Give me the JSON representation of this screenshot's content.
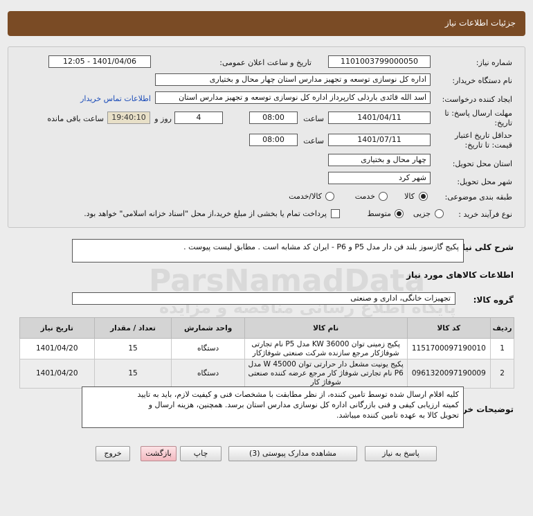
{
  "header": {
    "title": "جزئیات اطلاعات نیاز"
  },
  "form": {
    "need_number": {
      "label": "شماره نیاز:",
      "value": "1101003799000050"
    },
    "announce": {
      "label": "تاریخ و ساعت اعلان عمومی:",
      "value": "1401/04/06 - 12:05"
    },
    "buyer": {
      "label": "نام دستگاه خریدار:",
      "value": "اداره کل نوسازی  توسعه و تجهیز مدارس استان چهار محال و بختیاری"
    },
    "creator": {
      "label": "ایجاد کننده درخواست:",
      "value": "اسد الله قائدی بارذلی کارپرداز اداره کل نوسازی  توسعه و تجهیز مدارس استان",
      "contact_link": "اطلاعات تماس خریدار"
    },
    "deadline": {
      "label": "مهلت ارسال پاسخ: تا",
      "label2": "تاریخ:",
      "date": "1401/04/11",
      "time_label": "ساعت",
      "time": "08:00",
      "days": "4",
      "days_label": "روز و",
      "remaining": "19:40:10",
      "remaining_label": "ساعت باقی مانده"
    },
    "validity": {
      "label": "حداقل تاریخ اعتبار",
      "label2": "قیمت: تا تاریخ:",
      "date": "1401/07/11",
      "time_label": "ساعت",
      "time": "08:00"
    },
    "province": {
      "label": "استان محل تحویل:",
      "value": "چهار محال و بختیاری"
    },
    "city": {
      "label": "شهر محل تحویل:",
      "value": "شهر کرد"
    },
    "category": {
      "label": "طبقه بندی موضوعی:",
      "options": [
        "کالا",
        "خدمت",
        "کالا/خدمت"
      ],
      "selected": "کالا"
    },
    "process": {
      "label": "نوع فرآیند خرید :",
      "options": [
        "جزیی",
        "متوسط"
      ],
      "selected": "متوسط",
      "note": "پرداخت تمام یا بخشی از مبلغ خرید،از محل \"اسناد خزانه اسلامی\" خواهد بود."
    }
  },
  "description": {
    "label": "شرح کلی نیاز:",
    "value": "پکیج گازسوز بلند فن دار مدل P5 و P6 - ایران کد مشابه است . مطابق لیست پیوست ."
  },
  "goods_info": {
    "title": "اطلاعات کالاهای مورد نیاز"
  },
  "goods_group": {
    "label": "گروه کالا:",
    "value": "تجهیزات خانگی، اداری و صنعتی"
  },
  "table": {
    "headers": [
      "ردیف",
      "کد کالا",
      "نام کالا",
      "واحد شمارش",
      "تعداد / مقدار",
      "تاریخ نیاز"
    ],
    "rows": [
      {
        "index": "1",
        "code": "1151700097190010",
        "name": "پکیج زمینی توان KW 36000 مدل P5 نام تجارتی شوفاژکار مرجع سازنده شرکت صنعتی شوفاژکار",
        "unit": "دستگاه",
        "qty": "15",
        "date": "1401/04/20"
      },
      {
        "index": "2",
        "code": "0961320097190009",
        "name": "پکیج یونیت مشعل دار حرارتی توان W 45000 مدل P6 نام تجارتی شوفاژ کار مرجع عرضه کننده صنعتی شوفاژ کار",
        "unit": "دستگاه",
        "qty": "15",
        "date": "1401/04/20"
      }
    ]
  },
  "buyer_notes": {
    "label": "توضیحات خریدار:",
    "lines": [
      "کلیه اقلام ارسال شده توسط تامین کننده، از نظر مطابقت با مشخصات فنی و کیفیت لازم، باید به تایید",
      "کمیته ارزیابی کیفی و فنی بازرگانی  اداره کل نوسازی مدارس استان برسد. همچنین، هزینه ارسال و",
      "تحویل کالا به عهده تامین کننده میباشد."
    ]
  },
  "buttons": {
    "reply": "پاسخ به نیاز",
    "docs": "مشاهده مدارک پیوستی (3)",
    "print": "چاپ",
    "back": "بازگشت",
    "exit": "خروج"
  },
  "watermark": {
    "brand": "ParsNamadData",
    "tagline": "پایگاه اطلاع رسانی مناقصه و مزایده",
    "company": "پارس نماد داده"
  }
}
